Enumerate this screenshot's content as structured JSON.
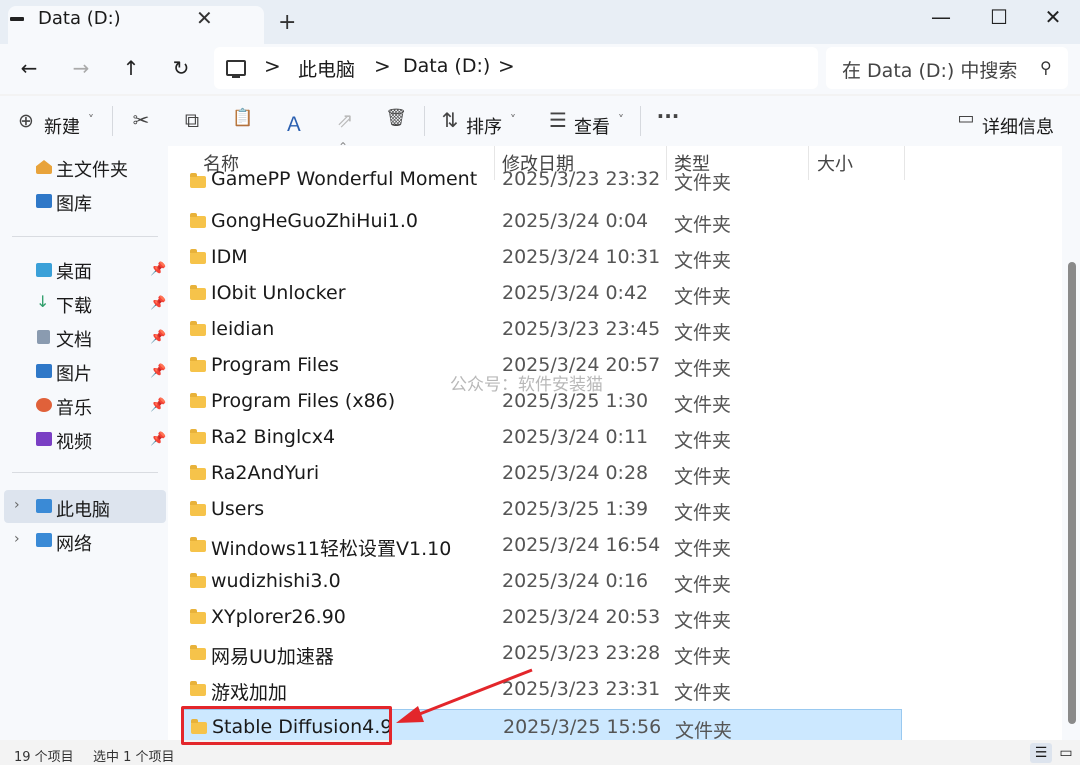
{
  "window": {
    "tab_title": "Data (D:)",
    "tab_close": "✕",
    "new_tab": "+",
    "minimize": "—",
    "maximize": "☐",
    "close": "✕"
  },
  "nav": {
    "back": "←",
    "forward": "→",
    "up": "↑",
    "refresh": "↻"
  },
  "address": {
    "crumbs": [
      "此电脑",
      "Data (D:)"
    ],
    "chevron": ">"
  },
  "search": {
    "placeholder": "在 Data (D:) 中搜索",
    "icon": "⚲"
  },
  "toolbar": {
    "new_label": "新建",
    "new_icon": "⊕",
    "caret": "˅",
    "cut_icon": "✂",
    "copy_icon": "⧉",
    "paste_icon": "📋",
    "rename_icon": "Ａ",
    "share_icon": "⇗",
    "delete_icon": "🗑",
    "sort_label": "排序",
    "sort_icon": "⇅",
    "view_label": "查看",
    "view_icon": "☰",
    "more": "···",
    "details_label": "详细信息",
    "details_icon": "▭"
  },
  "sidebar": {
    "items": [
      {
        "label": "主文件夹",
        "icon": "home-icon"
      },
      {
        "label": "图库",
        "icon": "gallery-icon"
      },
      {
        "label": "桌面",
        "icon": "desktop-icon",
        "pinned": true
      },
      {
        "label": "下载",
        "icon": "download-icon",
        "pinned": true
      },
      {
        "label": "文档",
        "icon": "document-icon",
        "pinned": true
      },
      {
        "label": "图片",
        "icon": "pictures-icon",
        "pinned": true
      },
      {
        "label": "音乐",
        "icon": "music-icon",
        "pinned": true
      },
      {
        "label": "视频",
        "icon": "video-icon",
        "pinned": true
      },
      {
        "label": "此电脑",
        "icon": "pc-icon",
        "selected": true
      },
      {
        "label": "网络",
        "icon": "network-icon"
      }
    ],
    "pin": "📌",
    "expander": "›"
  },
  "columns": {
    "name": "名称",
    "modified": "修改日期",
    "type": "类型",
    "size": "大小",
    "sort_indicator": "⌃"
  },
  "files": [
    {
      "name": "GamePP Wonderful Moment",
      "date": "2025/3/23 23:32",
      "type": "文件夹"
    },
    {
      "name": "GongHeGuoZhiHui1.0",
      "date": "2025/3/24 0:04",
      "type": "文件夹"
    },
    {
      "name": "IDM",
      "date": "2025/3/24 10:31",
      "type": "文件夹"
    },
    {
      "name": "IObit Unlocker",
      "date": "2025/3/24 0:42",
      "type": "文件夹"
    },
    {
      "name": "leidian",
      "date": "2025/3/23 23:45",
      "type": "文件夹"
    },
    {
      "name": "Program Files",
      "date": "2025/3/24 20:57",
      "type": "文件夹"
    },
    {
      "name": "Program Files (x86)",
      "date": "2025/3/25 1:30",
      "type": "文件夹"
    },
    {
      "name": "Ra2 Binglcx4",
      "date": "2025/3/24 0:11",
      "type": "文件夹"
    },
    {
      "name": "Ra2AndYuri",
      "date": "2025/3/24 0:28",
      "type": "文件夹"
    },
    {
      "name": "Users",
      "date": "2025/3/25 1:39",
      "type": "文件夹"
    },
    {
      "name": "Windows11轻松设置V1.10",
      "date": "2025/3/24 16:54",
      "type": "文件夹"
    },
    {
      "name": "wudizhishi3.0",
      "date": "2025/3/24 0:16",
      "type": "文件夹"
    },
    {
      "name": "XYplorer26.90",
      "date": "2025/3/24 20:53",
      "type": "文件夹"
    },
    {
      "name": "网易UU加速器",
      "date": "2025/3/23 23:28",
      "type": "文件夹"
    },
    {
      "name": "游戏加加",
      "date": "2025/3/23 23:31",
      "type": "文件夹"
    },
    {
      "name": "Stable Diffusion4.9",
      "date": "2025/3/25 15:56",
      "type": "文件夹",
      "selected": true
    }
  ],
  "status": {
    "count": "19 个项目",
    "selected": "选中 1 个项目"
  },
  "watermark": "公众号：软件安装猫",
  "colors": {
    "selection": "#cce8ff",
    "annotation": "#e3262b",
    "folder": "#f6c34a"
  }
}
